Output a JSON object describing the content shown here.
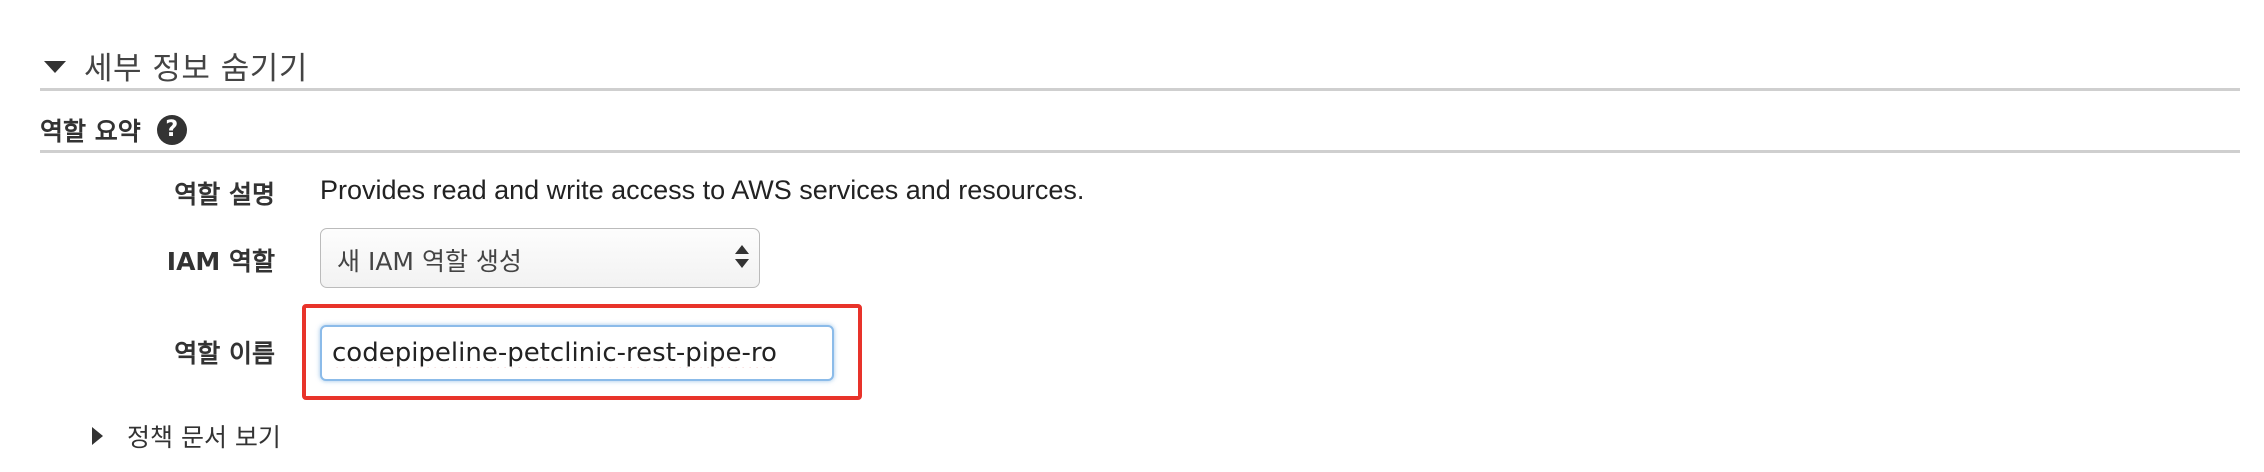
{
  "section": {
    "toggle_label": "세부 정보 숨기기"
  },
  "role_summary": {
    "title": "역할 요약",
    "help_icon": "?"
  },
  "rows": {
    "description_label": "역할 설명",
    "description_value": "Provides read and write access to AWS services and resources.",
    "iam_role_label": "IAM 역할",
    "iam_role_selected": "새 IAM 역할 생성",
    "role_name_label": "역할 이름",
    "role_name_value": "codepipeline-petclinic-rest-pipe-ro"
  },
  "policy": {
    "toggle_label": "정책 문서 보기"
  },
  "icons": {
    "section_caret": "caret-down-icon",
    "help": "help-circle-icon",
    "select_arrows": "select-arrows-icon",
    "policy_caret": "caret-right-icon"
  },
  "colors": {
    "highlight": "#e8332a",
    "input_focus": "#8bbbe9",
    "divider": "#cfcfcf"
  }
}
